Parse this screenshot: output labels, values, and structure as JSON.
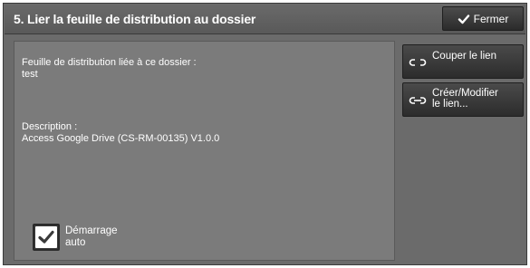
{
  "header": {
    "title": "5. Lier la feuille de distribution au dossier",
    "close_label": "Fermer"
  },
  "content": {
    "sheet_label": "Feuille de distribution liée à ce dossier :",
    "sheet_value": "test",
    "description_label": "Description :",
    "description_value": "Access Google Drive (CS-RM-00135) V1.0.0",
    "auto_start_label": "Démarrage auto",
    "auto_start_checked": true
  },
  "actions": {
    "unlink_label": "Couper le lien",
    "edit_link_label_line1": "Créer/Modifier",
    "edit_link_label_line2": "le lien..."
  },
  "icons": {
    "close": "check-icon",
    "unlink": "broken-link-icon",
    "link": "link-icon",
    "checkbox": "checkmark-icon"
  },
  "colors": {
    "background": "#6b6b6b",
    "panel": "#7b7b7b",
    "button": "#3a3a3a",
    "text": "#ffffff"
  }
}
